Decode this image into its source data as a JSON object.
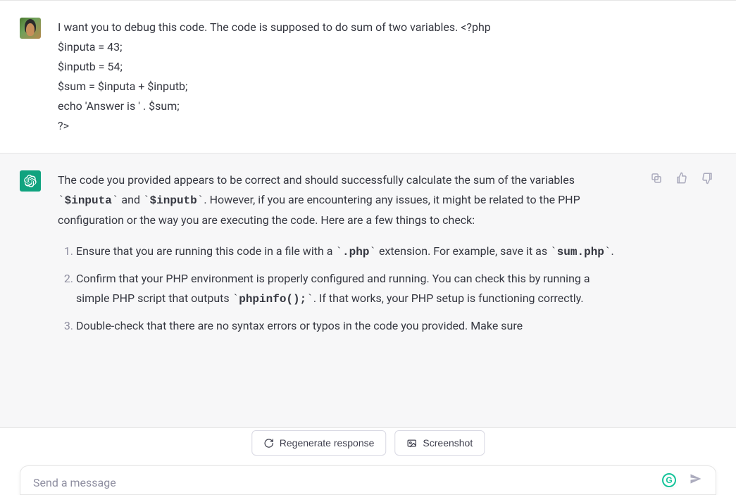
{
  "user_message": {
    "lines": [
      "I want you to debug this code. The code is supposed to do sum of two variables. <?php",
      "$inputa = 43;",
      "$inputb = 54;",
      "$sum = $inputa + $inputb;",
      "echo 'Answer is ' . $sum;",
      "?>"
    ]
  },
  "assistant_message": {
    "intro_part1": "The code you provided appears to be correct and should successfully calculate the sum of the variables ",
    "code_a": "$inputa",
    "intro_mid": " and ",
    "code_b": "$inputb",
    "intro_part2": ". However, if you are encountering any issues, it might be related to the PHP configuration or the way you are executing the code. Here are a few things to check:",
    "list": {
      "item1_a": "Ensure that you are running this code in a file with a ",
      "item1_code1": ".php",
      "item1_b": " extension. For example, save it as ",
      "item1_code2": "sum.php",
      "item1_c": ".",
      "item2_a": "Confirm that your PHP environment is properly configured and running. You can check this by running a simple PHP script that outputs ",
      "item2_code1": "phpinfo();",
      "item2_b": ". If that works, your PHP setup is functioning correctly.",
      "item3": "Double-check that there are no syntax errors or typos in the code you provided. Make sure"
    }
  },
  "buttons": {
    "regenerate": "Regenerate response",
    "screenshot": "Screenshot"
  },
  "composer": {
    "placeholder": "Send a message"
  },
  "icons": {
    "copy": "copy-icon",
    "thumbs_up": "thumbs-up-icon",
    "thumbs_down": "thumbs-down-icon",
    "refresh": "refresh-icon",
    "screenshot": "screenshot-icon",
    "send": "send-icon",
    "grammarly": "G"
  }
}
